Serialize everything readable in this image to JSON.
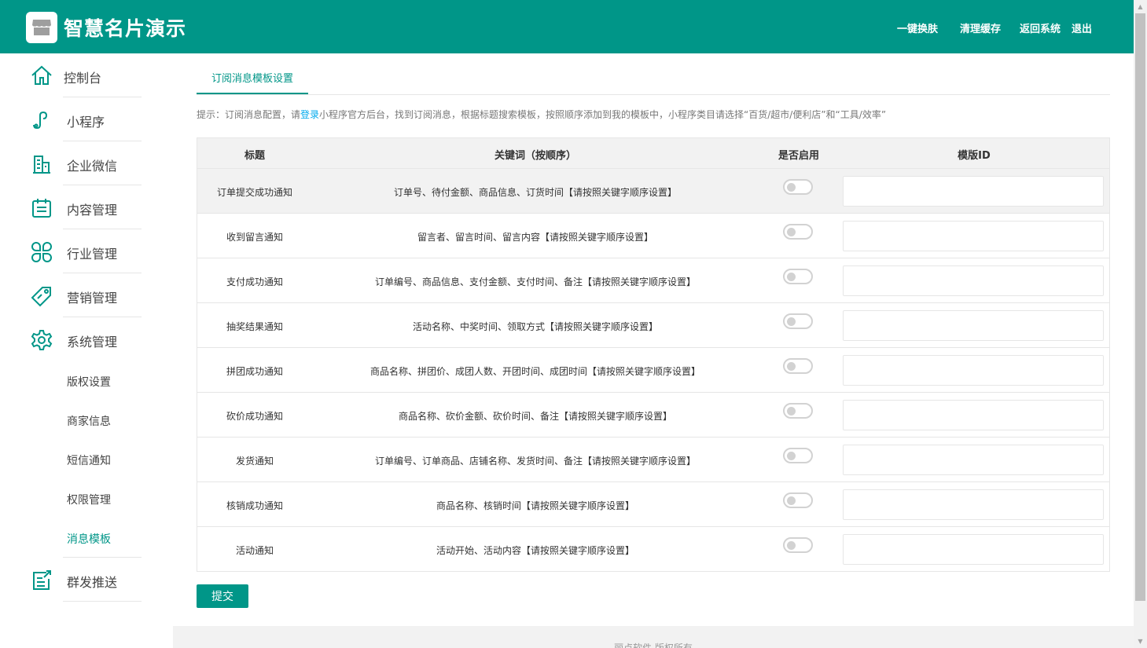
{
  "header": {
    "brand": "智慧名片演示",
    "links": [
      "一键换肤",
      "清理缓存",
      "返回系统",
      "退出"
    ]
  },
  "sidebar": {
    "items": [
      {
        "label": "控制台",
        "icon": "home-icon"
      },
      {
        "label": "小程序",
        "icon": "miniprogram-icon"
      },
      {
        "label": "企业微信",
        "icon": "building-icon"
      },
      {
        "label": "内容管理",
        "icon": "clipboard-icon"
      },
      {
        "label": "行业管理",
        "icon": "grid-icon"
      },
      {
        "label": "营销管理",
        "icon": "tag-icon"
      },
      {
        "label": "系统管理",
        "icon": "gear-icon"
      }
    ],
    "sub_items": [
      {
        "label": "版权设置"
      },
      {
        "label": "商家信息"
      },
      {
        "label": "短信通知"
      },
      {
        "label": "权限管理"
      },
      {
        "label": "消息模板"
      }
    ],
    "last_item": {
      "label": "群发推送",
      "icon": "send-list-icon"
    }
  },
  "main": {
    "tab": "订阅消息模板设置",
    "tip_prefix": "提示：订阅消息配置，请",
    "tip_link": "登录",
    "tip_suffix": "小程序官方后台，找到订阅消息，根据标题搜索模板，按照顺序添加到我的模板中，小程序类目请选择“百货/超市/便利店”和“工具/效率”",
    "columns": [
      "标题",
      "关键词（按顺序）",
      "是否启用",
      "模版ID"
    ],
    "rows": [
      {
        "title": "订单提交成功通知",
        "keywords": "订单号、待付金额、商品信息、订货时间【请按照关键字顺序设置】",
        "enabled": false,
        "template_id": ""
      },
      {
        "title": "收到留言通知",
        "keywords": "留言者、留言时间、留言内容【请按照关键字顺序设置】",
        "enabled": false,
        "template_id": ""
      },
      {
        "title": "支付成功通知",
        "keywords": "订单编号、商品信息、支付金额、支付时间、备注【请按照关键字顺序设置】",
        "enabled": false,
        "template_id": ""
      },
      {
        "title": "抽奖结果通知",
        "keywords": "活动名称、中奖时间、领取方式【请按照关键字顺序设置】",
        "enabled": false,
        "template_id": ""
      },
      {
        "title": "拼团成功通知",
        "keywords": "商品名称、拼团价、成团人数、开团时间、成团时间【请按照关键字顺序设置】",
        "enabled": false,
        "template_id": ""
      },
      {
        "title": "砍价成功通知",
        "keywords": "商品名称、砍价金额、砍价时间、备注【请按照关键字顺序设置】",
        "enabled": false,
        "template_id": ""
      },
      {
        "title": "发货通知",
        "keywords": "订单编号、订单商品、店铺名称、发货时间、备注【请按照关键字顺序设置】",
        "enabled": false,
        "template_id": ""
      },
      {
        "title": "核销成功通知",
        "keywords": "商品名称、核销时间【请按照关键字顺序设置】",
        "enabled": false,
        "template_id": ""
      },
      {
        "title": "活动通知",
        "keywords": "活动开始、活动内容【请按照关键字顺序设置】",
        "enabled": false,
        "template_id": ""
      }
    ],
    "submit": "提交",
    "footer": "丽点软件 版权所有"
  },
  "colors": {
    "primary": "#009688",
    "link": "#01AAED"
  }
}
